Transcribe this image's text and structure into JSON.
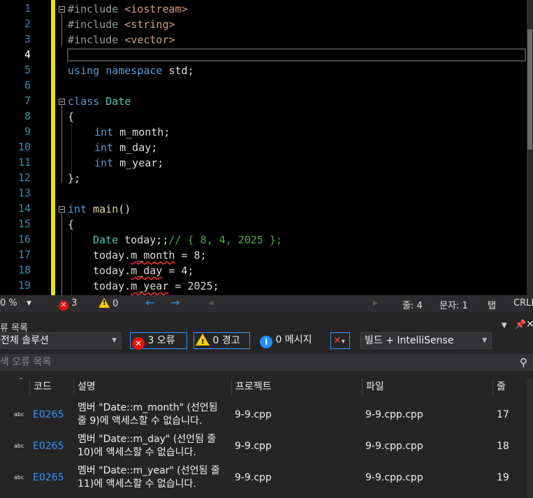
{
  "editor": {
    "line_numbers": [
      "1",
      "2",
      "3",
      "4",
      "5",
      "6",
      "7",
      "8",
      "9",
      "10",
      "11",
      "12",
      "13",
      "14",
      "15",
      "16",
      "17",
      "18",
      "19"
    ],
    "current_line": "4",
    "lines": {
      "l1": {
        "pre": "#include ",
        "inc": "<iostream>"
      },
      "l2": {
        "pre": "#include ",
        "inc": "<string>"
      },
      "l3": {
        "pre": "#include ",
        "inc": "<vector>"
      },
      "l5": {
        "kw1": "using",
        "kw2": "namespace",
        "rest": " std;"
      },
      "l7": {
        "kw": "class",
        "name": "Date"
      },
      "l8": "{",
      "l9": {
        "kw": "int",
        "rest": " m_month;"
      },
      "l10": {
        "kw": "int",
        "rest": " m_day;"
      },
      "l11": {
        "kw": "int",
        "rest": " m_year;"
      },
      "l12": "};",
      "l14": {
        "kw": "int",
        "fn": "main",
        "rest": "()"
      },
      "l15": "{",
      "l16": {
        "type": "Date",
        "rest": " today;;",
        "comment": "// { 8, 4, 2025 };"
      },
      "l17": {
        "obj": "today.",
        "member": "m_month",
        "rest": " = 8;"
      },
      "l18": {
        "obj": "today.",
        "member": "m_day",
        "rest": " = 4;"
      },
      "l19": {
        "obj": "today.",
        "member": "m_year",
        "rest": " = 2025;"
      }
    }
  },
  "editor_status": {
    "zoom": "0 %",
    "error_count": "3",
    "warning_count": "0",
    "line": "줄: 4",
    "col": "문자: 1",
    "tab": "탭",
    "eol": "CRLF"
  },
  "panel": {
    "title": "류 목록",
    "scope": "전체 솔루션",
    "errors_btn": "3 오류",
    "warnings_btn": "0 경고",
    "messages_btn": "0 메시지",
    "build_filter": "빌드 + IntelliSense",
    "search_placeholder": "색 오류 목록",
    "columns": {
      "code": "코드",
      "desc": "설명",
      "project": "프로젝트",
      "file": "파일",
      "line": "줄"
    },
    "rows": [
      {
        "icon": "abc",
        "code": "E0265",
        "desc1": "멤버 \"Date::m_month\" (선언됨",
        "desc2": "줄 9)에 액세스할 수 없습니다.",
        "project": "9-9.cpp",
        "file": "9-9.cpp.cpp",
        "line": "17"
      },
      {
        "icon": "abc",
        "code": "E0265",
        "desc1": "멤버 \"Date::m_day\" (선언됨 줄",
        "desc2": "10)에 액세스할 수 없습니다.",
        "project": "9-9.cpp",
        "file": "9-9.cpp.cpp",
        "line": "18"
      },
      {
        "icon": "abc",
        "code": "E0265",
        "desc1": "멤버 \"Date::m_year\" (선언됨 줄",
        "desc2": "11)에 액세스할 수 없습니다.",
        "project": "9-9.cpp",
        "file": "9-9.cpp.cpp",
        "line": "19"
      }
    ]
  },
  "colors": {
    "keyword": "#569cd6",
    "type": "#4ec9b0",
    "string": "#d69d85",
    "comment": "#57a64a",
    "line_number": "#2b91af",
    "link": "#3794ff"
  }
}
